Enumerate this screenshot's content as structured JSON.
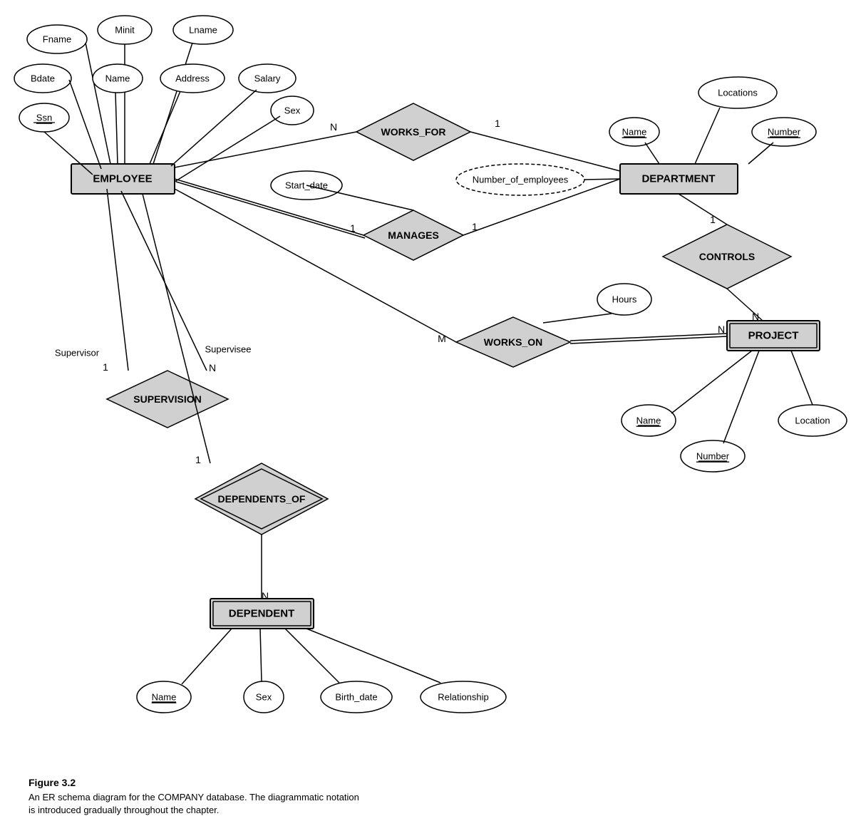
{
  "caption": {
    "title": "Figure 3.2",
    "line1": "An ER schema diagram for the COMPANY database. The diagrammatic notation",
    "line2": "is introduced gradually throughout the chapter."
  },
  "entities": {
    "employee": "EMPLOYEE",
    "department": "DEPARTMENT",
    "project": "PROJECT",
    "dependent": "DEPENDENT"
  },
  "relationships": {
    "works_for": "WORKS_FOR",
    "manages": "MANAGES",
    "works_on": "WORKS_ON",
    "controls": "CONTROLS",
    "supervision": "SUPERVISION",
    "dependents_of": "DEPENDENTS_OF"
  },
  "attributes": {
    "fname": "Fname",
    "minit": "Minit",
    "lname": "Lname",
    "bdate": "Bdate",
    "name_emp": "Name",
    "address": "Address",
    "salary": "Salary",
    "ssn": "Ssn",
    "sex_emp": "Sex",
    "start_date": "Start_date",
    "number_of_employees": "Number_of_employees",
    "locations": "Locations",
    "dept_name": "Name",
    "dept_number": "Number",
    "hours": "Hours",
    "proj_name": "Name",
    "proj_number": "Number",
    "location": "Location",
    "dep_name": "Name",
    "dep_sex": "Sex",
    "birth_date": "Birth_date",
    "relationship": "Relationship"
  },
  "cardinalities": {
    "n1": "N",
    "n2": "1",
    "n3": "1",
    "n4": "1",
    "m": "M",
    "n5": "N",
    "n6": "1",
    "n7": "N",
    "n8": "1",
    "n9": "N",
    "n10": "N"
  }
}
